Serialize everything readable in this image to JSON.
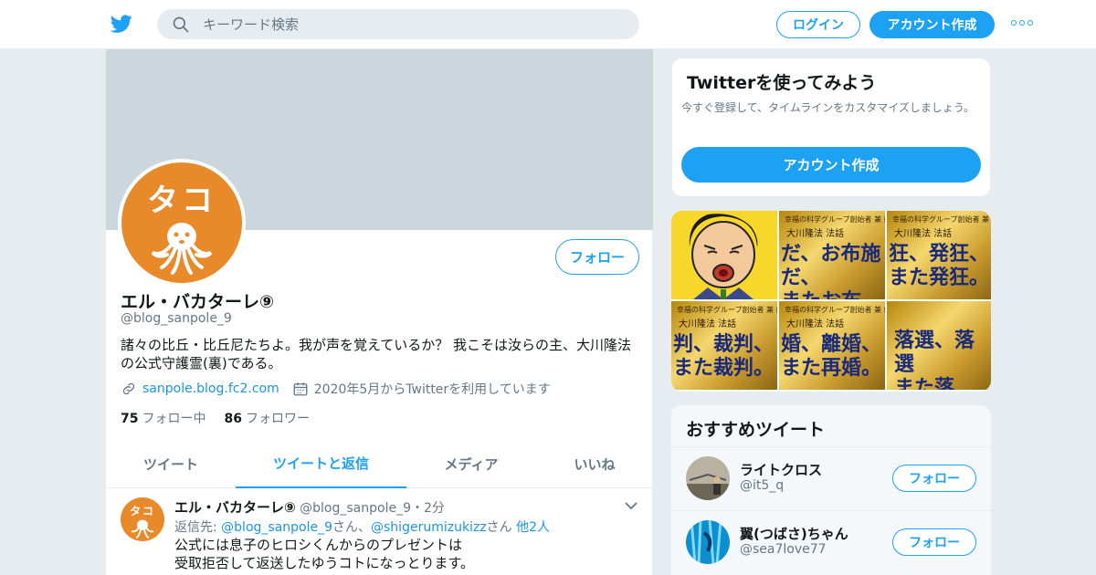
{
  "topbar": {
    "logo_icon": "twitter-bird-icon",
    "search_placeholder": "キーワード検索",
    "login_label": "ログイン",
    "signup_label": "アカウント作成",
    "more_icon": "more-dots-icon"
  },
  "profile": {
    "avatar_text": "タコ",
    "follow_label": "フォロー",
    "name": "エル・バカターレ⑨",
    "handle": "@blog_sanpole_9",
    "bio": "諸々の比丘・比丘尼たちよ。我が声を覚えているか？ 我こそは汝らの主、大川隆法の公式守護霊(裏)である。",
    "website": "sanpole.blog.fc2.com",
    "joined": "2020年5月からTwitterを利用しています",
    "following_count": "75",
    "following_label": "フォロー中",
    "followers_count": "86",
    "followers_label": "フォロワー"
  },
  "tabs": [
    "ツイート",
    "ツイートと返信",
    "メディア",
    "いいね"
  ],
  "tweet": {
    "name": "エル・バカターレ⑨",
    "handle": "@blog_sanpole_9",
    "time": "・2分",
    "reply_prefix": "返信先:",
    "reply_user1": "@blog_sanpole_9",
    "reply_san1": "さん、",
    "reply_user2": "@shigerumizukizz",
    "reply_san2": "さん",
    "reply_others": "他2人",
    "text": "公式には息子のヒロシくんからのプレゼントは\n受取拒否して返送したゆうコトになっとります。\n"
  },
  "signup_card": {
    "title": "Twitterを使ってみよう",
    "desc": "今すぐ登録して、タイムラインをカスタマイズしましょう。",
    "button": "アカウント作成"
  },
  "media": [
    {
      "kind": "face",
      "text": ""
    },
    {
      "kind": "gold",
      "header": "幸福の科学グループ創始者 兼 総裁",
      "header2": "大川隆法 法話",
      "text": "だ、お布施だ、\nまたお布施。"
    },
    {
      "kind": "gold",
      "header": "幸福の科学グループ創始者 兼 総裁",
      "header2": "大川隆法 法話",
      "text": "狂、発狂、\nまた発狂。"
    },
    {
      "kind": "gold",
      "header": "幸福の科学グループ創始者 兼 総裁",
      "header2": "大川隆法 法話",
      "text": "判、裁判、\nまた裁判。"
    },
    {
      "kind": "gold",
      "header": "幸福の科学グループ創始者 兼 総裁",
      "header2": "大川隆法 法話",
      "text": "婚、離婚、\nまた再婚。"
    },
    {
      "kind": "gold",
      "header": "",
      "header2": "",
      "text": "落選、落選\nまた落"
    }
  ],
  "recommend": {
    "title": "おすすめツイート",
    "follow_label": "フォロー",
    "items": [
      {
        "name": "ライトクロス",
        "handle": "@it5_q"
      },
      {
        "name": "翼(つばさ)ちゃん",
        "handle": "@sea7love77"
      }
    ]
  }
}
